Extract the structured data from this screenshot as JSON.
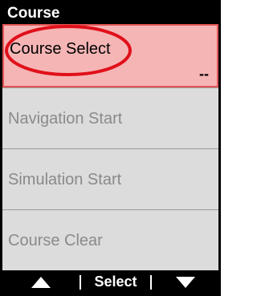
{
  "header": {
    "title": "Course"
  },
  "menu": {
    "items": [
      {
        "label": "Course Select",
        "value": "--",
        "selected": true
      },
      {
        "label": "Navigation Start"
      },
      {
        "label": "Simulation Start"
      },
      {
        "label": "Course Clear"
      }
    ]
  },
  "footer": {
    "up_icon": "triangle-up-icon",
    "select_label": "Select",
    "down_icon": "triangle-down-icon"
  },
  "colors": {
    "selected_fill": "#f5b5b5",
    "selected_border": "#e35555",
    "highlight_ellipse": "#e0101a",
    "item_bg": "#dcdcdc",
    "item_text": "#8a8a8a"
  }
}
